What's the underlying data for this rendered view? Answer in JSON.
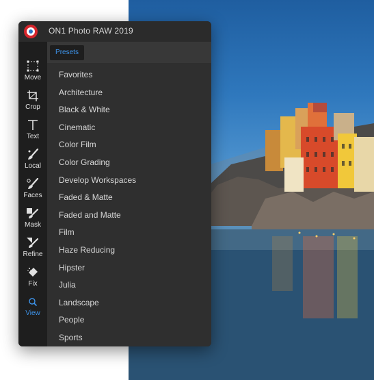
{
  "app": {
    "title": "ON1 Photo RAW 2019"
  },
  "toolbar": {
    "tools": [
      {
        "label": "Move",
        "icon": "move-icon"
      },
      {
        "label": "Crop",
        "icon": "crop-icon"
      },
      {
        "label": "Text",
        "icon": "text-icon"
      },
      {
        "label": "Local",
        "icon": "brush-icon"
      },
      {
        "label": "Faces",
        "icon": "face-brush-icon"
      },
      {
        "label": "Mask",
        "icon": "mask-brush-icon"
      },
      {
        "label": "Refine",
        "icon": "refine-brush-icon"
      },
      {
        "label": "Fix",
        "icon": "eraser-icon"
      },
      {
        "label": "View",
        "icon": "search-icon",
        "active": true
      }
    ]
  },
  "panel": {
    "tab": "Presets",
    "presets": [
      "Favorites",
      "Architecture",
      "Black & White",
      "Cinematic",
      "Color Film",
      "Color Grading",
      "Develop Workspaces",
      "Faded & Matte",
      "Faded and Matte",
      "Film",
      "Haze Reducing",
      "Hipster",
      "Julia",
      "Landscape",
      "People",
      "Sports"
    ]
  },
  "colors": {
    "accent": "#3d93ea",
    "window": "#282828",
    "panel": "#2f2f2f",
    "toolbar": "#1e1e1e"
  }
}
